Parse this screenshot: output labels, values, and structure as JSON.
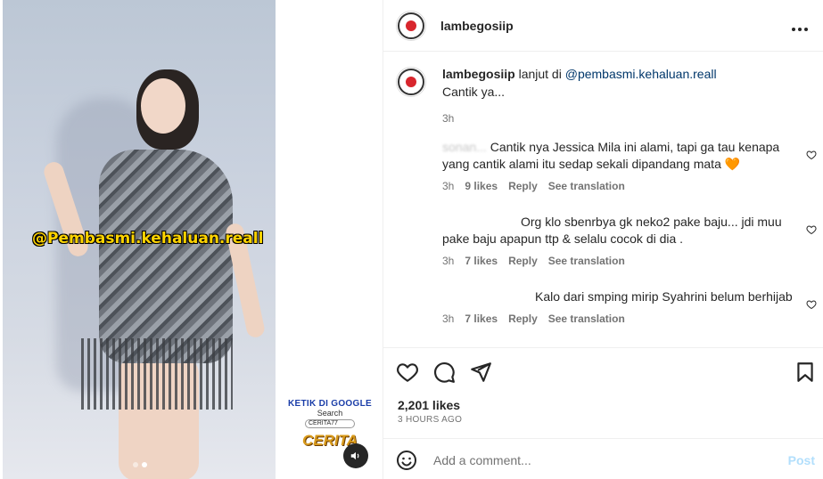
{
  "post": {
    "username": "lambegosiip",
    "more_icon": "more-horizontal-icon",
    "more_label": "•••"
  },
  "media": {
    "watermark": "@Pembasmi.kehaluan.reall",
    "carousel_dots": 2,
    "ad": {
      "line1": "KETIK DI GOOGLE",
      "line2": "Search",
      "search_text": "CERITA77",
      "brand": "CERITA"
    },
    "sound_icon": "speaker-icon",
    "sound_label": "🔊"
  },
  "caption": {
    "username": "lambegosiip",
    "prefix": "lanjut di",
    "mention": "@pembasmi.kehaluan.reall",
    "text": "Cantik ya...",
    "time": "3h"
  },
  "comments": [
    {
      "username": "sonan...",
      "text": "Cantik nya Jessica Mila ini alami, tapi ga tau kenapa yang cantik alami itu sedap sekali dipandang mata 🧡",
      "time": "3h",
      "likes": "9 likes",
      "reply": "Reply",
      "see_translation": "See translation"
    },
    {
      "username": "",
      "text": "Org klo sbenrbya gk neko2 pake baju... jdi muu pake baju apapun ttp & selalu cocok di dia .",
      "time": "3h",
      "likes": "7 likes",
      "reply": "Reply",
      "see_translation": "See translation"
    },
    {
      "username": "",
      "text": "Kalo dari smping mirip Syahrini belum berhijab",
      "time": "3h",
      "likes": "7 likes",
      "reply": "Reply",
      "see_translation": "See translation"
    }
  ],
  "stats": {
    "likes": "2,201 likes",
    "time_ago": "3 HOURS AGO"
  },
  "composer": {
    "placeholder": "Add a comment...",
    "post_label": "Post"
  },
  "colors": {
    "text": "#262626",
    "muted": "#737373",
    "link": "#00376b",
    "post_disabled": "#b2dffc"
  }
}
